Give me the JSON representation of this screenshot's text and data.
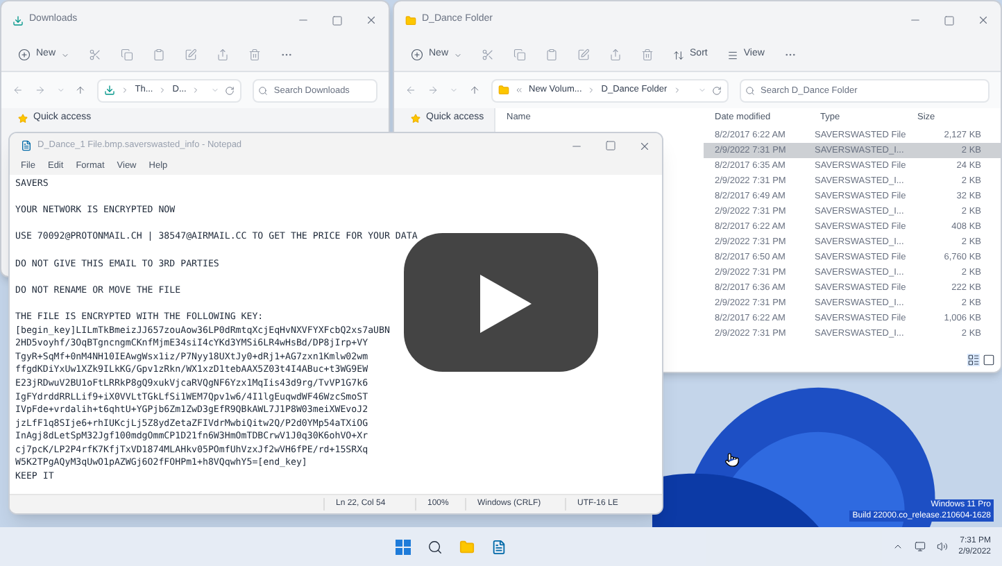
{
  "downloads_window": {
    "title": "Downloads",
    "new_button": "New",
    "address": [
      "Th...",
      "D..."
    ],
    "search": {
      "placeholder": "Search Downloads"
    },
    "sidebar": [
      "Quick access"
    ]
  },
  "folder_window": {
    "title": "D_Dance Folder",
    "new_button": "New",
    "sort_button": "Sort",
    "view_button": "View",
    "address": [
      "New Volum...",
      "D_Dance Folder"
    ],
    "search": {
      "placeholder": "Search D_Dance Folder"
    },
    "sidebar": [
      "Quick access"
    ],
    "table": {
      "columns": [
        "Name",
        "Date modified",
        "Type",
        "Size"
      ],
      "rows": [
        {
          "date": "8/2/2017 6:22 AM",
          "type": "SAVERSWASTED File",
          "size": "2,127 KB",
          "selected": false
        },
        {
          "date": "2/9/2022 7:31 PM",
          "type": "SAVERSWASTED_I...",
          "size": "2 KB",
          "selected": true
        },
        {
          "date": "8/2/2017 6:35 AM",
          "type": "SAVERSWASTED File",
          "size": "24 KB",
          "selected": false
        },
        {
          "date": "2/9/2022 7:31 PM",
          "type": "SAVERSWASTED_I...",
          "size": "2 KB",
          "selected": false
        },
        {
          "date": "8/2/2017 6:49 AM",
          "type": "SAVERSWASTED File",
          "size": "32 KB",
          "selected": false
        },
        {
          "date": "2/9/2022 7:31 PM",
          "type": "SAVERSWASTED_I...",
          "size": "2 KB",
          "selected": false
        },
        {
          "date": "8/2/2017 6:22 AM",
          "type": "SAVERSWASTED File",
          "size": "408 KB",
          "selected": false
        },
        {
          "date": "2/9/2022 7:31 PM",
          "type": "SAVERSWASTED_I...",
          "size": "2 KB",
          "selected": false
        },
        {
          "date": "8/2/2017 6:50 AM",
          "type": "SAVERSWASTED File",
          "size": "6,760 KB",
          "selected": false
        },
        {
          "date": "2/9/2022 7:31 PM",
          "type": "SAVERSWASTED_I...",
          "size": "2 KB",
          "selected": false
        },
        {
          "date": "8/2/2017 6:36 AM",
          "type": "SAVERSWASTED File",
          "size": "222 KB",
          "selected": false
        },
        {
          "date": "2/9/2022 7:31 PM",
          "type": "SAVERSWASTED_I...",
          "size": "2 KB",
          "selected": false
        },
        {
          "date": "8/2/2017 6:22 AM",
          "type": "SAVERSWASTED File",
          "size": "1,006 KB",
          "selected": false
        },
        {
          "date": "2/9/2022 7:31 PM",
          "type": "SAVERSWASTED_I...",
          "size": "2 KB",
          "selected": false
        }
      ]
    }
  },
  "notepad": {
    "title": "D_Dance_1 File.bmp.saverswasted_info - Notepad",
    "menu": [
      "File",
      "Edit",
      "Format",
      "View",
      "Help"
    ],
    "paragraphs": [
      [
        "SAVERS"
      ],
      [
        "YOUR NETWORK IS ENCRYPTED NOW"
      ],
      [
        "USE 70092@PROTONMAIL.CH | 38547@AIRMAIL.CC TO GET THE PRICE FOR YOUR DATA"
      ],
      [
        "DO NOT GIVE THIS EMAIL TO 3RD PARTIES"
      ],
      [
        "DO NOT RENAME OR MOVE THE FILE"
      ],
      [
        "THE FILE IS ENCRYPTED WITH THE FOLLOWING KEY:",
        "[begin_key]LILmTkBmeizJJ657zouAow36LP0dRmtqXcjEqHvNXVFYXFcbQ2xs7aUBN",
        "2HD5voyhf/3OqBTgncngmCKnfMjmE34siI4cYKd3YMSi6LR4wHsBd/DP8jIrp+VY",
        "TgyR+SqMf+0nM4NH10IEAwgWsx1iz/P7Nyy18UXtJy0+dRj1+AG7zxn1Kmlw02wm",
        "ffgdKDiYxUw1XZk9ILkKG/Gpv1zRkn/WX1xzD1tebAAX5Z03t4I4ABuc+t3WG9EW",
        "E23jRDwuV2BU1oFtLRRkP8gQ9xukVjcaRVQgNF6Yzx1MqIis43d9rg/TvVP1G7k6",
        "IgFYdrddRRLLif9+iX0VVLtTGkLfSi1WEM7Qpv1w6/4I1lgEuqwdWF46WzcSmoST",
        "IVpFde+vrdalih+t6qhtU+YGPjb6Zm1ZwD3gEfR9QBkAWL7J1P8W03meiXWEvoJ2",
        "jzLfF1q8SIje6+rhIUKcjLj5Z8ydZetaZFIVdrMwbiQitw2Q/P2d0YMp54aTXiOG",
        "InAgj8dLetSpM32Jgf100mdgOmmCP1D21fn6W3HmOmTDBCrwV1J0q30K6ohVO+Xr",
        "cj7pcK/LP2P4rfK7KfjTxVD1874MLAHkv05POmfUhVzxJf2wVH6fPE/rd+15SRXq",
        "W5K2TPgAQyM3qUwO1pAZWGj6O2fFOHPm1+h8VQqwhY5=[end_key]",
        "KEEP IT"
      ]
    ],
    "status_bar": [
      "Ln 22, Col 54",
      "100%",
      "Windows (CRLF)",
      "UTF-16 LE"
    ]
  },
  "desktop": {
    "edition": "Windows 11 Pro",
    "build": "Build 22000.co_release.210604-1628"
  },
  "taskbar": {
    "time": "7:31 PM",
    "date": "2/9/2022"
  }
}
